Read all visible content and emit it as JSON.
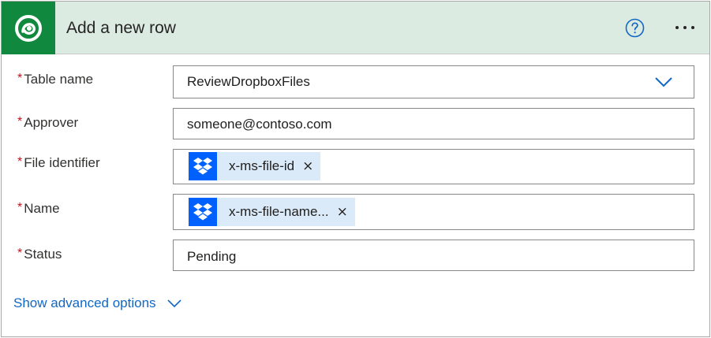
{
  "header": {
    "title": "Add a new row",
    "accent_color": "#10893e",
    "header_bg": "#dcebe2",
    "logo_icon": "dataverse-logo-icon",
    "help_icon": "help-circle-icon",
    "more_icon": "ellipsis-icon"
  },
  "fields": {
    "table_name": {
      "label": "Table name",
      "required": "*",
      "value": "ReviewDropboxFiles",
      "control": "dropdown"
    },
    "approver": {
      "label": "Approver",
      "required": "*",
      "value": "someone@contoso.com"
    },
    "file_identifier": {
      "label": "File identifier",
      "required": "*",
      "token": "x-ms-file-id",
      "token_icon": "dropbox-icon",
      "remove": "×"
    },
    "name": {
      "label": "Name",
      "required": "*",
      "token": "x-ms-file-name...",
      "token_icon": "dropbox-icon",
      "remove": "×"
    },
    "status": {
      "label": "Status",
      "required": "*",
      "value": "Pending"
    }
  },
  "advanced": {
    "label": "Show advanced options",
    "icon": "chevron-down-icon",
    "link_color": "#1167c5"
  }
}
